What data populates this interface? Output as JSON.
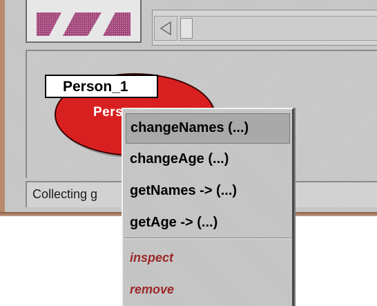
{
  "toolbar": {
    "icon": "striped-pattern-icon"
  },
  "scrollbar": {
    "arrow_icon": "scroll-left-arrow-icon"
  },
  "object_bench": {
    "object": {
      "name": "Person_1",
      "type_label": "Pers",
      "color": "#d92020"
    }
  },
  "status_bar": {
    "text": "Collecting g"
  },
  "popup_menu": {
    "method_items": [
      "changeNames (...)",
      "changeAge (...)",
      "getNames -> (...)",
      "getAge -> (...)"
    ],
    "system_items": [
      "inspect",
      "remove"
    ],
    "selected_index": 0,
    "system_item_color": "#9b2828"
  }
}
